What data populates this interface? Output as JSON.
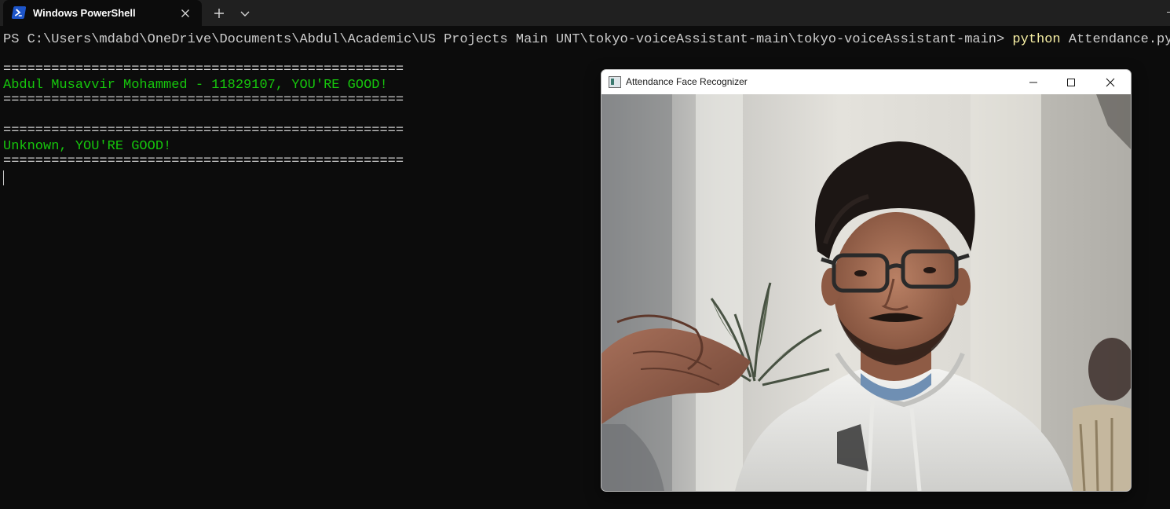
{
  "tab": {
    "title": "Windows PowerShell",
    "icon": "powershell-icon",
    "close_icon": "close-icon"
  },
  "tabbar": {
    "new_tab_icon": "plus-icon",
    "dropdown_icon": "chevron-down-icon"
  },
  "terminal": {
    "prompt": "PS C:\\Users\\mdabd\\OneDrive\\Documents\\Abdul\\Academic\\US Projects Main UNT\\tokyo-voiceAssistant-main\\tokyo-voiceAssistant-main> ",
    "command": "python",
    "argument": " Attendance.py",
    "separator": "==================================================",
    "result_1": "Abdul Musavvir Mohammed - 11829107, YOU'RE GOOD!",
    "result_2": "Unknown, YOU'RE GOOD!"
  },
  "window": {
    "title": "Attendance Face Recognizer",
    "app_icon": "opencv-window-icon",
    "minimize_icon": "minimize-icon",
    "maximize_icon": "maximize-icon",
    "close_icon": "close-icon"
  },
  "colors": {
    "terminal_bg": "#0c0c0c",
    "terminal_text": "#cccccc",
    "command_yellow": "#f9f1a5",
    "success_green": "#16c60c",
    "tabbar_bg": "#202020"
  }
}
